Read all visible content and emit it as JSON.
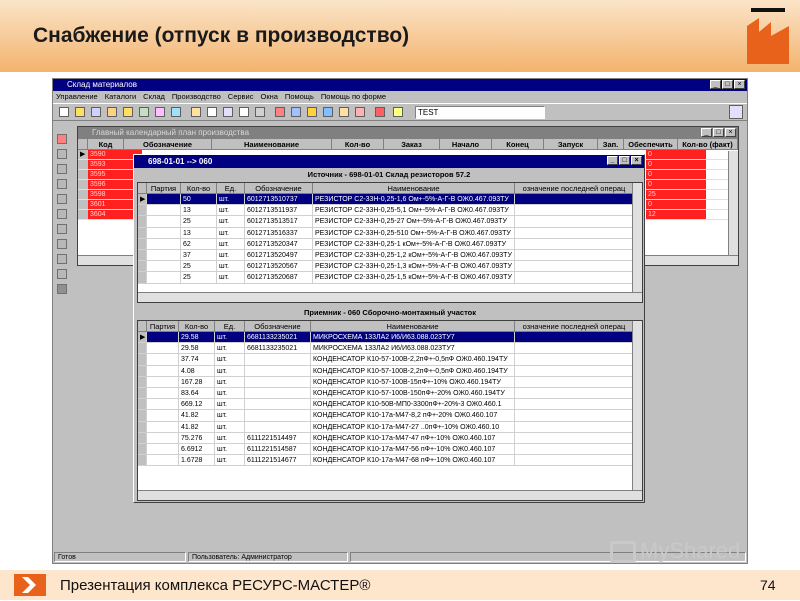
{
  "slide": {
    "title": "Снабжение (отпуск в производство)",
    "footer_text": "Презентация комплекса РЕСУРС-МАСТЕР®",
    "page_number": "74",
    "watermark": "MyShared"
  },
  "app": {
    "title": "Склад материалов",
    "menu": [
      "Управление",
      "Каталоги",
      "Склад",
      "Производство",
      "Сервис",
      "Окна",
      "Помощь",
      "Помощь по форме"
    ],
    "toolbar_input_value": "TEST",
    "status_left": "Готов",
    "status_user": "Пользователь: Администратор"
  },
  "plan_window": {
    "title": "Главный календарный план производства",
    "columns": [
      "Код",
      "Обозначение",
      "Наименование",
      "Кол-во",
      "Заказ",
      "Начало",
      "Конец",
      "Запуск",
      "Зап.",
      "Обеспечить",
      "Кол-во (факт)"
    ],
    "codes": [
      "3590",
      "3593",
      "3595",
      "3596",
      "3598",
      "3601",
      "3604"
    ],
    "fact_values": [
      "0",
      "0",
      "0",
      "0",
      "25",
      "0",
      "12"
    ]
  },
  "modal": {
    "title": "698-01-01 --> 060",
    "source_caption": "Источник - 698-01-01 Склад резисторов 57.2",
    "source_columns": [
      "Партия",
      "Кол-во",
      "Ед.",
      "Обозначение",
      "Наименование",
      "означение последней операц"
    ],
    "source_rows": [
      {
        "qty": "50",
        "unit": "шт.",
        "code": "6012713510737",
        "name": "РЕЗИСТОР С2-33Н-0,25-1,6 Ом+-5%-А-Г-В ОЖ0.467.093ТУ"
      },
      {
        "qty": "13",
        "unit": "шт.",
        "code": "6012713511937",
        "name": "РЕЗИСТОР С2-33Н-0,25-5,1 Ом+-5%-А-Г-В ОЖ0.467.093ТУ"
      },
      {
        "qty": "25",
        "unit": "шт.",
        "code": "6012713513517",
        "name": "РЕЗИСТОР С2-33Н-0,25-27 Ом+-5%-А-Г-В ОЖ0.467.093ТУ"
      },
      {
        "qty": "13",
        "unit": "шт.",
        "code": "6012713516337",
        "name": "РЕЗИСТОР С2-33Н-0,25-510 Ом+-5%-А-Г-В ОЖ0.467.093ТУ"
      },
      {
        "qty": "62",
        "unit": "шт.",
        "code": "6012713520347",
        "name": "РЕЗИСТОР С2-33Н-0,25-1 кОм+-5%-А-Г-В ОЖ0.467.093ТУ"
      },
      {
        "qty": "37",
        "unit": "шт.",
        "code": "6012713520497",
        "name": "РЕЗИСТОР С2-33Н-0,25-1,2 кОм+-5%-А-Г-В ОЖ0.467.093ТУ"
      },
      {
        "qty": "25",
        "unit": "шт.",
        "code": "6012713520567",
        "name": "РЕЗИСТОР С2-33Н-0,25-1,3 кОм+-5%-А-Г-В ОЖ0.467.093ТУ"
      },
      {
        "qty": "25",
        "unit": "шт.",
        "code": "6012713520687",
        "name": "РЕЗИСТОР С2-33Н-0,25-1,5 кОм+-5%-А-Г-В ОЖ0.467.093ТУ"
      }
    ],
    "target_caption": "Приемник - 060 Сборочно-монтажный участок",
    "target_columns": [
      "Партия",
      "Кол-во",
      "Ед.",
      "Обозначение",
      "Наименование",
      "означение последней операц"
    ],
    "target_rows": [
      {
        "qty": "29.58",
        "unit": "шт.",
        "code": "6681133235021",
        "name": "МИКРОСХЕМА 133ЛА2 И6/И63.088.023ТУ7"
      },
      {
        "qty": "29.58",
        "unit": "шт.",
        "code": "6681133235021",
        "name": "МИКРОСХЕМА 133ЛА2 И6/И63.088.023ТУ7"
      },
      {
        "qty": "37.74",
        "unit": "шт.",
        "code": "",
        "name": "КОНДЕНСАТОР К10-57-100В-2,2пФ+-0,5пФ ОЖ0.460.194ТУ"
      },
      {
        "qty": "4.08",
        "unit": "шт.",
        "code": "",
        "name": "КОНДЕНСАТОР К10-57-100В-2,2пФ+-0,5пФ ОЖ0.460.194ТУ"
      },
      {
        "qty": "167.28",
        "unit": "шт.",
        "code": "",
        "name": "КОНДЕНСАТОР К10-57-100В-15пФ+-10% ОЖ0.460.194ТУ"
      },
      {
        "qty": "83.64",
        "unit": "шт.",
        "code": "",
        "name": "КОНДЕНСАТОР К10-57-100В-150пФ+-20% ОЖ0.460.194ТУ"
      },
      {
        "qty": "669.12",
        "unit": "шт.",
        "code": "",
        "name": "КОНДЕНСАТОР К10-50В-МП0-3300пФ+-20%-3 ОЖ0.460.1"
      },
      {
        "qty": "41.82",
        "unit": "шт.",
        "code": "",
        "name": "КОНДЕНСАТОР К10-17а-М47-8,2 пФ+-20% ОЖ0.460.107"
      },
      {
        "qty": "41.82",
        "unit": "шт.",
        "code": "",
        "name": "КОНДЕНСАТОР К10-17а-М47-27 ..0пФ+-10% ОЖ0.460.10"
      },
      {
        "qty": "75.276",
        "unit": "шт.",
        "code": "6111221514497",
        "name": "КОНДЕНСАТОР К10-17а-М47-47 пФ+-10% ОЖ0.460.107"
      },
      {
        "qty": "6.6912",
        "unit": "шт.",
        "code": "6111221514587",
        "name": "КОНДЕНСАТОР К10-17а-М47-56 пФ+-10% ОЖ0.460.107"
      },
      {
        "qty": "1.6728",
        "unit": "шт.",
        "code": "6111221514677",
        "name": "КОНДЕНСАТОР К10-17а-М47-68 пФ+-10% ОЖ0.460.107"
      }
    ]
  }
}
